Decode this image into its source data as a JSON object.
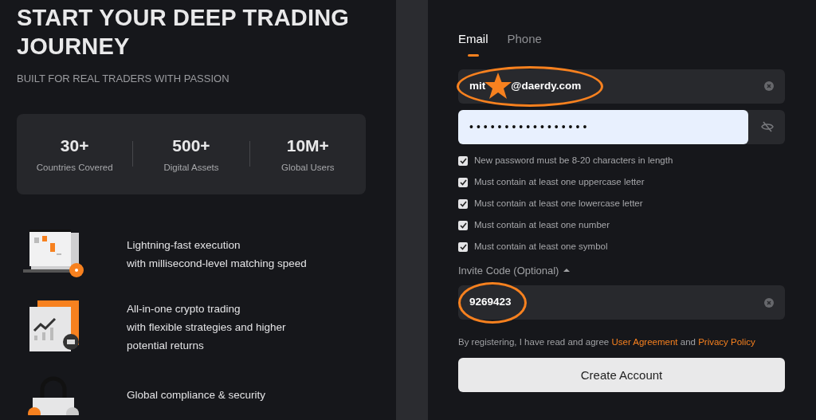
{
  "hero": {
    "title": "START YOUR DEEP TRADING JOURNEY",
    "subtitle": "BUILT FOR REAL TRADERS WITH PASSION"
  },
  "stats": [
    {
      "value": "30+",
      "label": "Countries Covered"
    },
    {
      "value": "500+",
      "label": "Digital Assets"
    },
    {
      "value": "10M+",
      "label": "Global Users"
    }
  ],
  "features": [
    {
      "kind": "laptop",
      "lines": [
        "Lightning-fast execution",
        "with millisecond-level matching speed"
      ]
    },
    {
      "kind": "chart",
      "lines": [
        "All-in-one crypto trading",
        "with flexible strategies and higher",
        "potential returns"
      ]
    },
    {
      "kind": "lock",
      "lines": [
        "Global compliance & security"
      ]
    }
  ],
  "tabs": [
    {
      "label": "Email",
      "selected": true
    },
    {
      "label": "Phone",
      "selected": false
    }
  ],
  "email": {
    "value_start": "mit",
    "value_end": "@daerdy.com"
  },
  "password": {
    "value": "•••••••••••••••••"
  },
  "rules": [
    {
      "text": "New password must be 8-20 characters in length",
      "checked": true
    },
    {
      "text": "Must contain at least one uppercase letter",
      "checked": true
    },
    {
      "text": "Must contain at least one lowercase letter",
      "checked": true
    },
    {
      "text": "Must contain at least one number",
      "checked": true
    },
    {
      "text": "Must contain at least one symbol",
      "checked": true
    }
  ],
  "invite": {
    "label": "Invite Code (Optional)",
    "expanded": true,
    "value": "9269423"
  },
  "agreement": {
    "text": "By registering, I have read and agree",
    "link1": "User Agreement",
    "joiner": "and",
    "link2": "Privacy Policy"
  },
  "submit": "Create Account"
}
